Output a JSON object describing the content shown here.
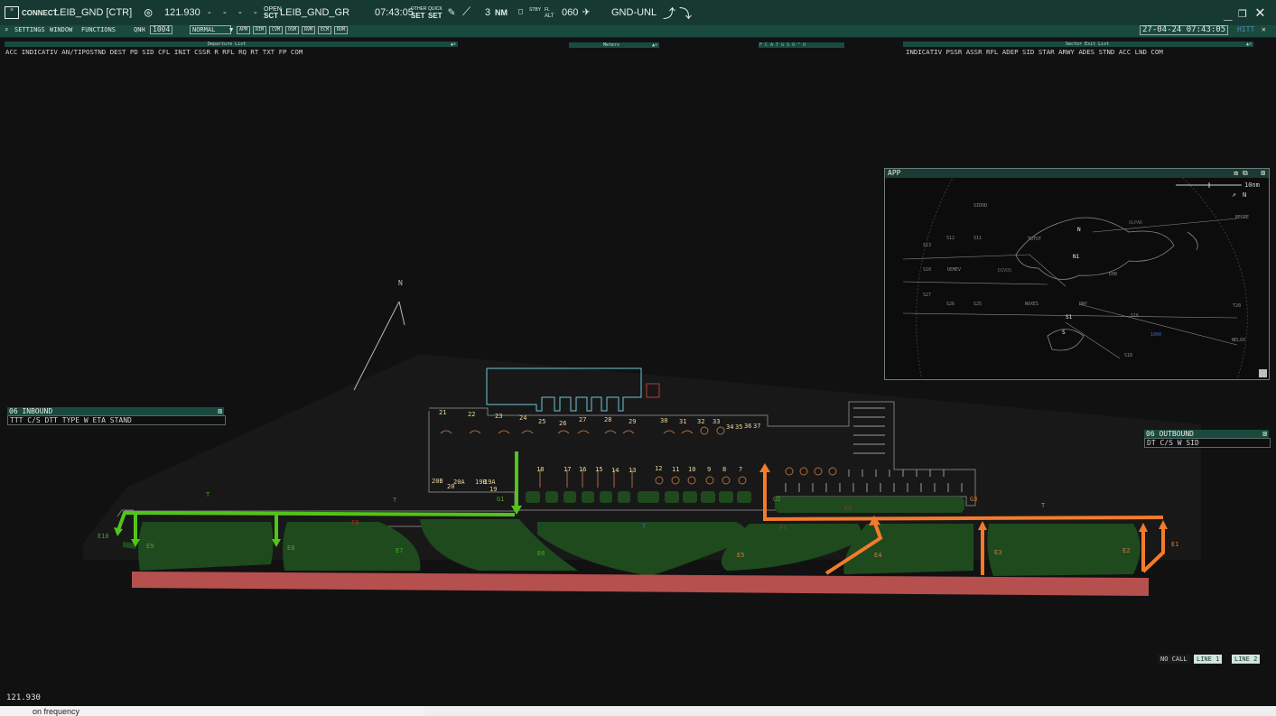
{
  "topbar": {
    "menu_icon": "menu-icon",
    "connect_label": "CONNECT",
    "callsign": "LEIB_GND [CTR]",
    "frequency": "121.930",
    "dashes": [
      "-",
      "-",
      "-",
      "-"
    ],
    "open_label": "OPEN",
    "sct_label": "SCT",
    "sct_value": "LEIB_GND_GR",
    "utc_time": "07:43:05",
    "other_label": "OTHER",
    "quick_label": "QUICK",
    "set_label_1": "SET",
    "set_label_2": "SET",
    "range_value": "3",
    "range_unit": "NM",
    "stby_label": "STBY",
    "alt_label": "ALT",
    "fl_label": "FL",
    "fl_value": "060",
    "gnd_label": "GND-UNL",
    "window_controls": [
      "minimize-icon",
      "restore-icon",
      "close-icon"
    ]
  },
  "toolbar": {
    "settings": "SETTINGS",
    "window": "WINDOW",
    "functions": "FUNCTIONS",
    "qnh_label": "QNH",
    "qnh_value": "1004",
    "mode": "NORMAL",
    "buttons": [
      "APM",
      "RIM",
      "CVM",
      "OSM",
      "RVM",
      "ECM",
      "RUM"
    ],
    "date_time": "27-04-24 07:43:05",
    "hitt": "HITT"
  },
  "departure_list": {
    "title": "Departure List",
    "columns": "ACC    INDICATIV AN/TIPOSTND  DEST   PD    SID    CFL  INIT  CSSR  R  RFL  RQ  RT      TXT      FP COM"
  },
  "meters": {
    "title": "Meters"
  },
  "mini_tools": "F C A T G S O ^ U",
  "sector_exit": {
    "title": "Sector Exit List",
    "columns": "INDICATIV PSSR ASSR RFL ADEP   SID    STAR  ARWY ADES STND  ACC LND COM"
  },
  "inbound": {
    "title": "06 INBOUND",
    "columns": "TTT   C/S         DTT TYPE W ETA   STAND"
  },
  "outbound": {
    "title": "06 OUTBOUND",
    "columns": "DT    C/S          W SID"
  },
  "app_window": {
    "title": "APP",
    "scale": "10nm",
    "north": "N",
    "fixes": [
      "SIDOD",
      "TUTOT",
      "REGRE",
      "OLPAR",
      "DEMEV",
      "DIVOS",
      "NOXES",
      "NELOX",
      "N",
      "N1",
      "S1",
      "S",
      "S12",
      "S11",
      "S13",
      "S10",
      "S26",
      "S25",
      "S27",
      "S16",
      "S18",
      "T20",
      "1000",
      "RWY",
      "E08"
    ]
  },
  "airport_map": {
    "north_label": "N",
    "stands_row1": [
      "21",
      "22",
      "23",
      "24",
      "25",
      "26",
      "27",
      "28",
      "29",
      "30",
      "31",
      "32",
      "33",
      "34",
      "35",
      "36",
      "37"
    ],
    "stands_row2": [
      "18",
      "17",
      "16",
      "15",
      "14",
      "13",
      "12",
      "11",
      "10",
      "9",
      "8",
      "7"
    ],
    "stands_small": [
      "20B",
      "20",
      "20A",
      "19B",
      "19A",
      "19"
    ],
    "taxi_labels": [
      "T",
      "T",
      "T",
      "T",
      "T"
    ],
    "gate_labels": [
      "G1",
      "G2",
      "G3"
    ],
    "exit_labels": [
      "E10",
      "E9",
      "E8",
      "E7",
      "E6",
      "E5",
      "E4",
      "E3",
      "E2",
      "E1"
    ],
    "extra_labels": [
      "F8",
      "F3",
      "E6"
    ]
  },
  "bottom": {
    "frequency": "121.930",
    "command": "on frequency",
    "no_call": "NO CALL",
    "line1": "LINE 1",
    "line2": "LINE 2"
  },
  "colors": {
    "background": "#111111",
    "bar": "#163a31",
    "taxi_green": "#52c41a",
    "taxi_orange": "#f47b2b",
    "runway": "#b5504f",
    "apron": "#1e4a1e"
  }
}
